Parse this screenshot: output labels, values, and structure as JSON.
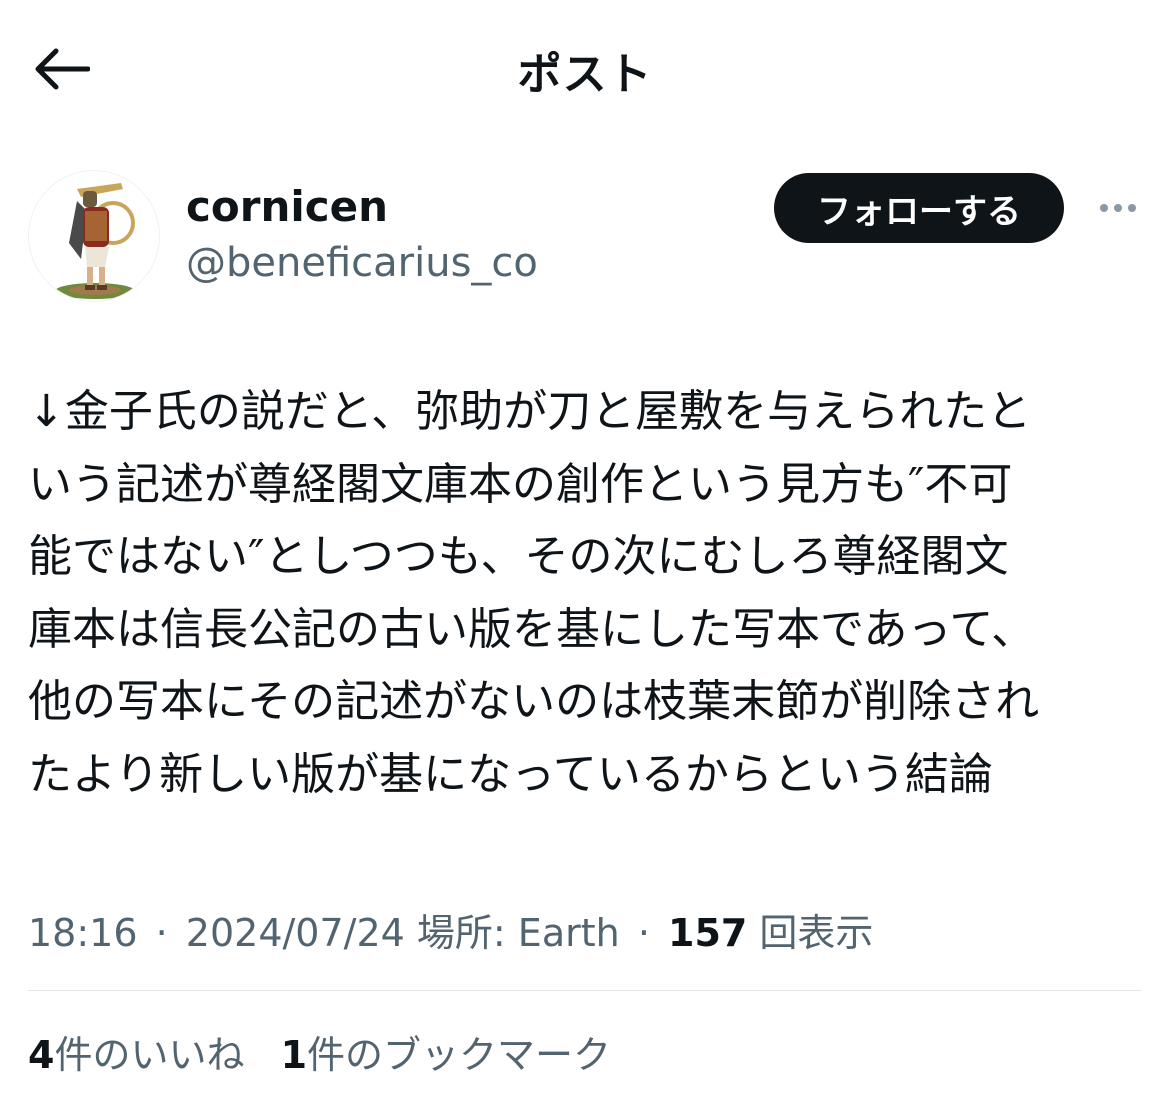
{
  "header": {
    "title": "ポスト",
    "back_icon": "arrow-left-icon"
  },
  "author": {
    "display_name": "cornicen",
    "handle": "@beneficarius_co",
    "follow_label": "フォローする",
    "more_icon": "more-horizontal-icon"
  },
  "post": {
    "lines": [
      "↓金子氏の説だと、弥助が刀と屋敷を与えられたと",
      "いう記述が尊経閣文庫本の創作という見方も″不可",
      "能ではない″としつつも、その次にむしろ尊経閣文",
      "庫本は信長公記の古い版を基にした写本であって、",
      "他の写本にその記述がないのは枝葉末節が削除され",
      "たより新しい版が基になっているからという結論"
    ]
  },
  "meta": {
    "time": "18:16",
    "dot": "·",
    "date": "2024/07/24",
    "location": "場所: Earth",
    "views_count": "157",
    "views_label": "回表示"
  },
  "stats": {
    "likes_count": "4",
    "likes_label": "件のいいね",
    "bookmarks_count": "1",
    "bookmarks_label": "件のブックマーク"
  },
  "colors": {
    "text": "#0f1419",
    "secondary": "#536471",
    "button_bg": "#0f1419",
    "divider": "#e1e6ea"
  }
}
